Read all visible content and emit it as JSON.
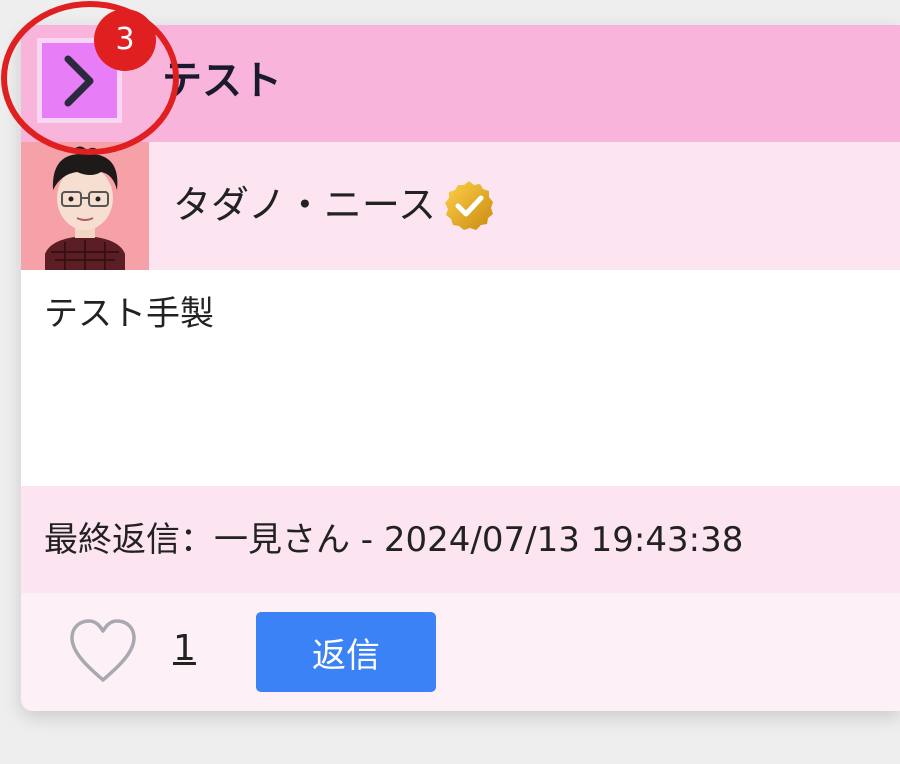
{
  "thread": {
    "title": "テスト",
    "author": "タダノ・ニース",
    "body": "テスト手製",
    "last_reply": "最終返信：一見さん - 2024/07/13 19:43:38",
    "like_count": "1",
    "reply_button_label": "返信",
    "notification_count": "3"
  },
  "colors": {
    "header_bg": "#f8b4da",
    "expand_button_bg": "#e77ef8",
    "author_row_bg": "#fce5f1",
    "reply_button_bg": "#3b82f6",
    "badge_red": "#e02020",
    "verified_gold": "#f0b429"
  },
  "icons": {
    "expand": "chevron-right-icon",
    "verified": "verified-check-icon",
    "like": "heart-icon"
  }
}
